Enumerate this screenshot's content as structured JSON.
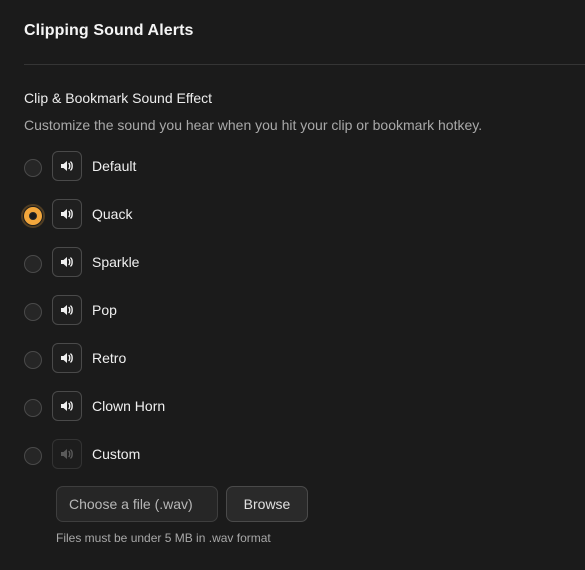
{
  "header": {
    "title": "Clipping Sound Alerts"
  },
  "section": {
    "title": "Clip & Bookmark Sound Effect",
    "description": "Customize the sound you hear when you hit your clip or bookmark hotkey."
  },
  "options": [
    {
      "label": "Default",
      "selected": false,
      "enabled": true
    },
    {
      "label": "Quack",
      "selected": true,
      "enabled": true
    },
    {
      "label": "Sparkle",
      "selected": false,
      "enabled": true
    },
    {
      "label": "Pop",
      "selected": false,
      "enabled": true
    },
    {
      "label": "Retro",
      "selected": false,
      "enabled": true
    },
    {
      "label": "Clown Horn",
      "selected": false,
      "enabled": true
    },
    {
      "label": "Custom",
      "selected": false,
      "enabled": false
    }
  ],
  "file_picker": {
    "placeholder": "Choose a file (.wav)",
    "browse_label": "Browse",
    "hint": "Files must be under 5 MB in .wav format"
  },
  "colors": {
    "background": "#1b1b1b",
    "accent": "#f3a73c",
    "icon_enabled": "#f0f0f0",
    "icon_disabled": "#5a5a5a"
  },
  "icons": {
    "play": "speaker-icon"
  }
}
